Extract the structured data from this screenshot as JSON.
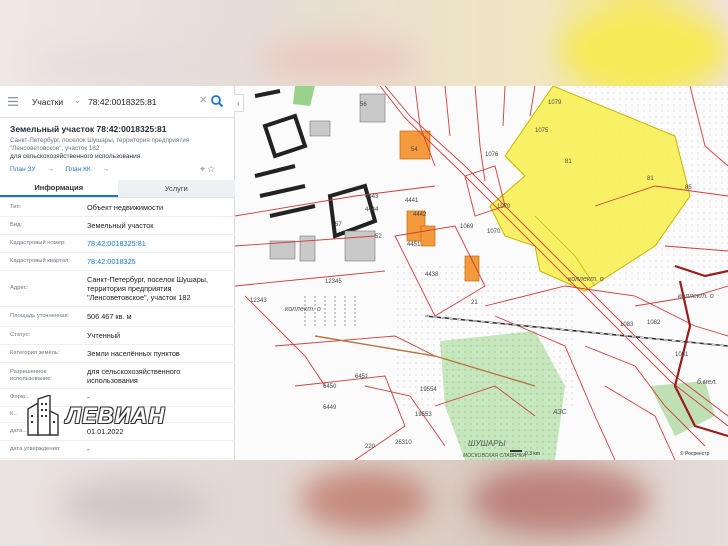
{
  "search": {
    "layer": "Участки",
    "query": "78:42:0018325:81"
  },
  "parcel": {
    "title": "Земельный участок 78:42:0018325:81",
    "address_small": "Санкт-Петербург, поселок Шушары, территория предприятия \"Ленсоветовское\", участок 182",
    "purpose": "для сельскохозяйственного использования",
    "links": [
      "План ЗУ",
      "План КК"
    ]
  },
  "tabs": [
    "Информация",
    "Услуги"
  ],
  "rows": [
    {
      "key": "Тип:",
      "value": "Объект недвижимости"
    },
    {
      "key": "Вид:",
      "value": "Земельный участок"
    },
    {
      "key": "Кадастровый номер:",
      "value": "78:42:0018325:81"
    },
    {
      "key": "Кадастровый квартал:",
      "value": "78:42:0018325"
    },
    {
      "key": "Адрес:",
      "value": "Санкт-Петербург, поселок Шушары, территория предприятия \"Ленсоветовское\", участок 182"
    },
    {
      "key": "Площадь уточненная:",
      "value": "506 467 кв. м"
    },
    {
      "key": "Статус:",
      "value": "Учтенный"
    },
    {
      "key": "Категория земель:",
      "value": "Земли населённых пунктов"
    },
    {
      "key": "Разрешенное использование:",
      "value": "для сельскохозяйственного использования"
    },
    {
      "key": "Форм...",
      "value": "-"
    },
    {
      "key": "К...",
      "value": ""
    },
    {
      "key": "дата...",
      "value": "01.01.2022"
    },
    {
      "key": "дата утверждения:",
      "value": "-"
    }
  ],
  "map_labels": {
    "parcels": [
      "1075",
      "1079",
      "1076",
      "1070",
      "1069",
      "1070",
      "81",
      "85",
      "81",
      "4441",
      "4442",
      "4443",
      "4444",
      "4438",
      "4451",
      "6451",
      "6450",
      "6449",
      "19554",
      "19553",
      "1083",
      "1082",
      "1081",
      "52",
      "56",
      "57",
      "54",
      "12343",
      "12345",
      "21",
      "220",
      "26310"
    ],
    "places": [
      "коллект. о",
      "коллект. о",
      "коллект. о",
      "АЗС",
      "ШУШАРЫ",
      "МОСКОВСКАЯ СЛАВЯНКА",
      "б.мел."
    ],
    "scale": "0.3 km",
    "copyright": "© Росреестр"
  },
  "logo": {
    "text": "ЛЕВИАН"
  },
  "colors": {
    "accent": "#1976d2",
    "parcel_border": "#d23c3c",
    "selected_fill": "#f7ee4a",
    "orange": "#f39a3c",
    "green": "#b7ddb0"
  }
}
